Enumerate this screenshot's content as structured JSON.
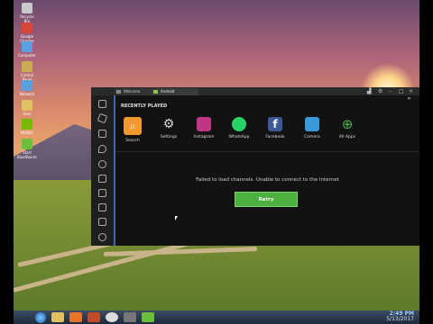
{
  "desktop": {
    "icons": [
      {
        "name": "recycle-bin-icon",
        "label": "Recycle Bin",
        "color": "#c9c9c9"
      },
      {
        "name": "chrome-icon",
        "label": "Google Chrome",
        "color": "#d8453a"
      },
      {
        "name": "computer-icon",
        "label": "Computer",
        "color": "#5aa0e0"
      },
      {
        "name": "control-panel-icon",
        "label": "Control Panel",
        "color": "#c8ad55"
      },
      {
        "name": "network-icon",
        "label": "Network",
        "color": "#5aa0e0"
      },
      {
        "name": "user-folder-icon",
        "label": "User",
        "color": "#e0c060"
      },
      {
        "name": "nvidia-icon",
        "label": "NVIDIA",
        "color": "#76b900"
      },
      {
        "name": "bluestacks-icon",
        "label": "Start BlueStacks",
        "color": "#6bbf3c"
      }
    ]
  },
  "emulator": {
    "tabs": [
      {
        "label": "Welcome"
      },
      {
        "label": "Android"
      }
    ],
    "section_title": "RECENTLY PLAYED",
    "apps": [
      {
        "label": "Search",
        "icon": "search-icon",
        "color": "#f29a2e",
        "selected": true
      },
      {
        "label": "Settings",
        "icon": "settings-gear-icon",
        "color": "#121212"
      },
      {
        "label": "Instagram",
        "icon": "instagram-icon",
        "color": "#c13584"
      },
      {
        "label": "WhatsApp",
        "icon": "whatsapp-icon",
        "color": "#25d366"
      },
      {
        "label": "Facebook",
        "icon": "facebook-icon",
        "color": "#3b5998"
      },
      {
        "label": "Camera",
        "icon": "camera-icon",
        "color": "#3a9ad9"
      },
      {
        "label": "All Apps",
        "icon": "all-apps-plus-icon",
        "color": "#121212"
      }
    ],
    "error_message": "Failed to load channels. Unable to connect to the Internet",
    "retry_label": "Retry"
  },
  "taskbar": {
    "time": "2:49 PM",
    "date": "5/13/2017"
  }
}
